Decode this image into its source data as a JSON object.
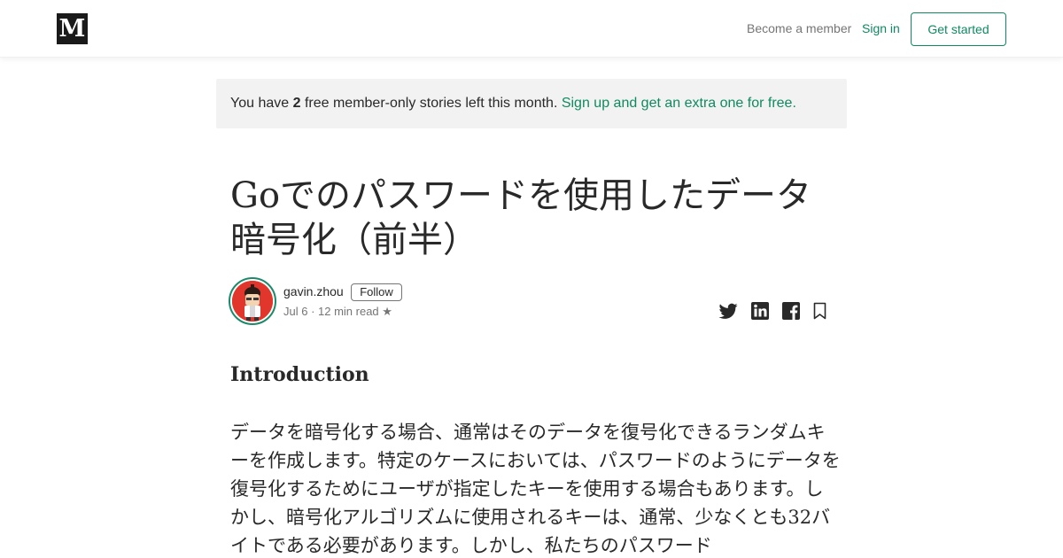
{
  "header": {
    "logo_letter": "M",
    "become_member": "Become a member",
    "sign_in": "Sign in",
    "get_started": "Get started"
  },
  "banner": {
    "prefix": "You have ",
    "count": "2",
    "suffix": " free member-only stories left this month. ",
    "cta": "Sign up and get an extra one for free."
  },
  "article": {
    "title": "Goでのパスワードを使用したデータ暗号化（前半）",
    "author": "gavin.zhou",
    "follow": "Follow",
    "meta": "Jul 6 · 12 min read ★",
    "heading": "Introduction",
    "paragraph": "データを暗号化する場合、通常はそのデータを復号化できるランダムキーを作成します。特定のケースにおいては、パスワードのようにデータを復号化するためにユーザが指定したキーを使用する場合もあります。しかし、暗号化アルゴリズムに使用されるキーは、通常、少なくとも32バイトである必要があります。しかし、私たちのパスワード"
  },
  "icons": {
    "twitter": "twitter-icon",
    "linkedin": "linkedin-icon",
    "facebook": "facebook-icon",
    "bookmark": "bookmark-icon"
  },
  "colors": {
    "accent": "#0f8a5f",
    "banner_bg": "#f2f2f2",
    "text": "#292929",
    "muted": "#757575"
  }
}
